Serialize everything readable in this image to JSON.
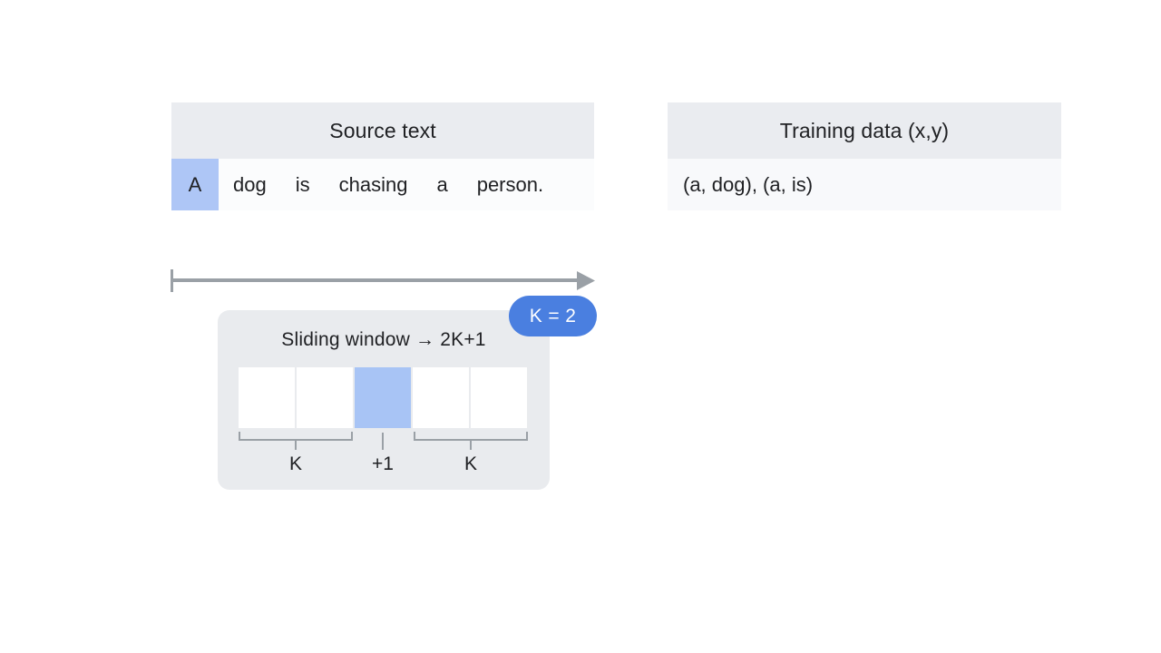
{
  "source_panel": {
    "title": "Source text",
    "tokens": [
      {
        "text": "A",
        "highlighted": true
      },
      {
        "text": "dog",
        "highlighted": false
      },
      {
        "text": "is",
        "highlighted": false
      },
      {
        "text": "chasing",
        "highlighted": false
      },
      {
        "text": "a",
        "highlighted": false
      },
      {
        "text": "person.",
        "highlighted": false
      }
    ]
  },
  "training_panel": {
    "title": "Training data (x,y)",
    "value": "(a, dog), (a, is)"
  },
  "axis": {
    "icon": "right-arrow-icon",
    "color": "#9aa0a6"
  },
  "window_card": {
    "title": "Sliding window → 2K+1",
    "cells": [
      {
        "state": "empty"
      },
      {
        "state": "empty"
      },
      {
        "state": "center"
      },
      {
        "state": "empty"
      },
      {
        "state": "empty"
      }
    ],
    "bracket_labels": {
      "left": "K",
      "middle": "+1",
      "right": "K"
    }
  },
  "badge": {
    "label": "K = 2",
    "color": "#4a7fe0"
  },
  "colors": {
    "page_background": "#ffffff",
    "panel_header": "#eaecf0",
    "panel_body": "#f8f9fb",
    "highlight_blue": "#aec6f6",
    "cell_center_blue": "#a8c4f5",
    "card_background": "#e9ebee",
    "text": "#202124",
    "line_gray": "#9aa0a6"
  }
}
